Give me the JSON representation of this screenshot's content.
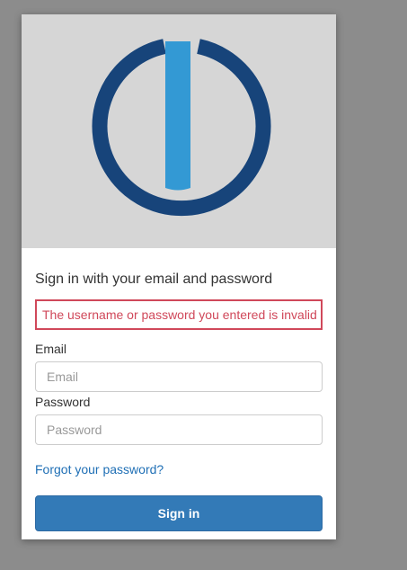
{
  "logo": {
    "icon": "ioBroker-logo-icon",
    "ring_color": "#17447a",
    "bar_color": "#3399d4",
    "banner_color": "#d6d6d6"
  },
  "login": {
    "heading": "Sign in with your email and password",
    "error_message": "The username or password you entered is invalid",
    "email_label": "Email",
    "email_placeholder": "Email",
    "email_value": "",
    "password_label": "Password",
    "password_placeholder": "Password",
    "password_value": "",
    "forgot_link": "Forgot your password?",
    "submit_label": "Sign in"
  },
  "colors": {
    "error": "#d0485a",
    "link": "#1f6fb5",
    "button": "#337ab7",
    "backdrop": "#8c8c8c"
  }
}
